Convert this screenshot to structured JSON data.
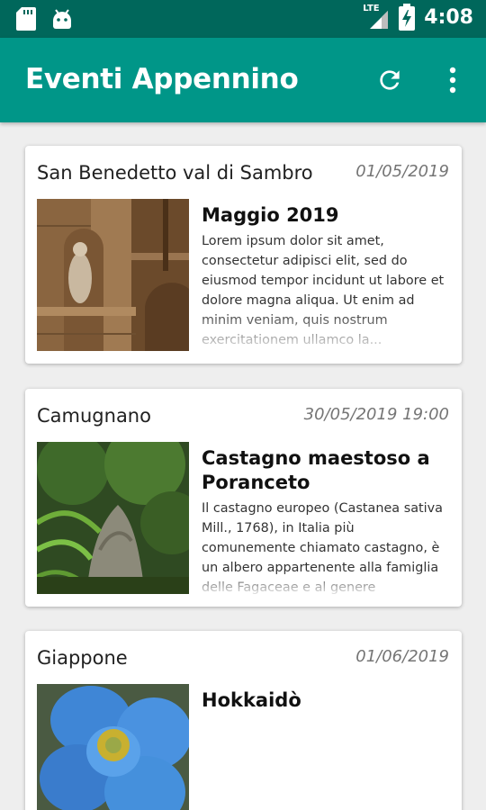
{
  "status_bar": {
    "time": "4:08",
    "network": "LTE",
    "left_icons": [
      "sd-card-icon",
      "android-icon"
    ],
    "right_icons": [
      "signal-icon",
      "battery-charging-icon"
    ],
    "bg_color": "#00675b"
  },
  "app_bar": {
    "title": "Eventi Appennino",
    "actions": [
      "refresh-icon",
      "more-vert-icon"
    ],
    "bg_color": "#009688"
  },
  "events": [
    {
      "location": "San Benedetto val di Sambro",
      "date": "01/05/2019",
      "title": "Maggio 2019",
      "text": "Lorem ipsum dolor sit amet, consectetur adipisci elit, sed do eiusmod tempor incidunt ut labore et dolore magna aliqua. Ut enim ad minim veniam, quis nostrum exercitationem ullamco la...",
      "image": "church-facade-image"
    },
    {
      "location": "Camugnano",
      "date": "30/05/2019 19:00",
      "title": "Castagno maestoso a Poranceto",
      "text": "Il castagno europeo (Castanea sativa Mill., 1768), in Italia più comunemente chiamato castagno, è un albero appartenente alla famiglia delle Fagaceae e al genere",
      "image": "chestnut-tree-image"
    },
    {
      "location": "Giappone",
      "date": "01/06/2019",
      "title": "Hokkaidò",
      "text": "",
      "image": "blue-flower-image"
    }
  ]
}
